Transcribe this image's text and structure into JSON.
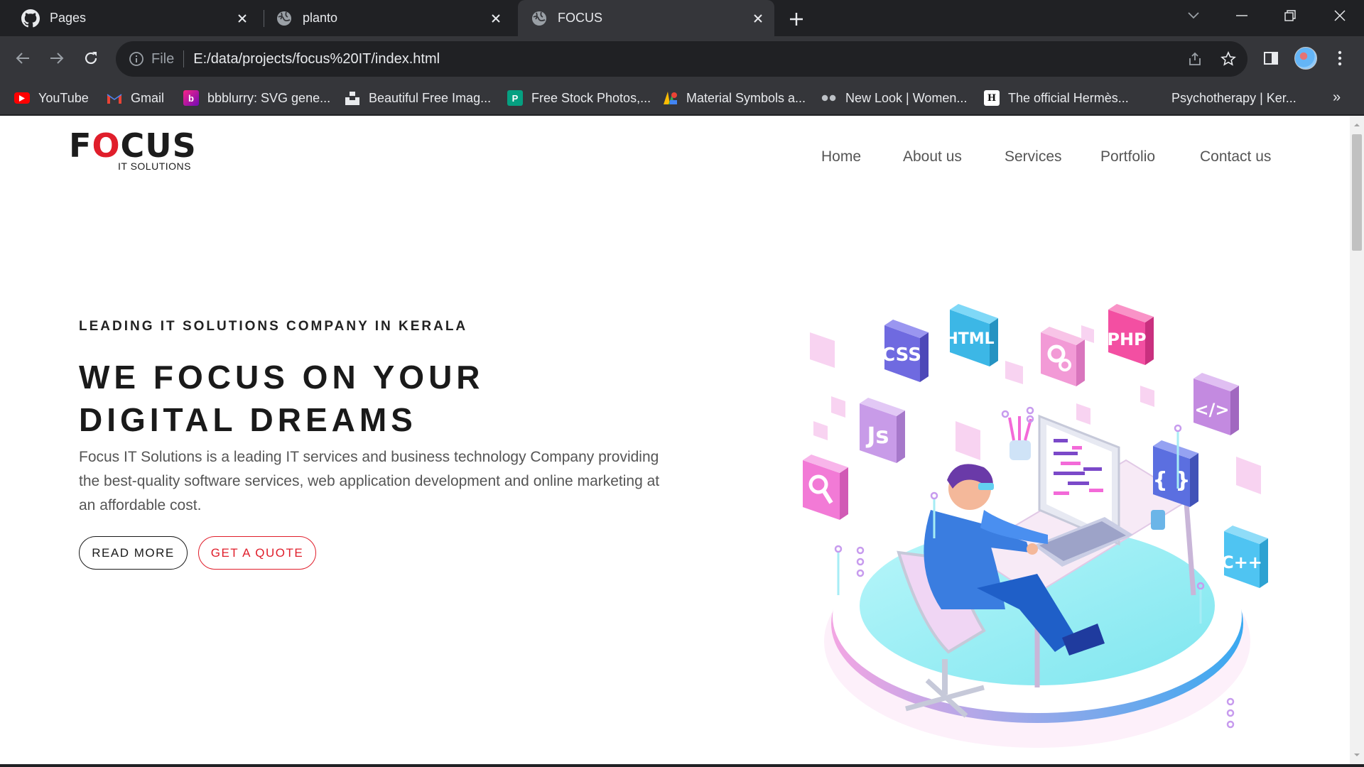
{
  "browser": {
    "tabs": [
      {
        "title": "Pages",
        "icon": "github-icon",
        "active": false
      },
      {
        "title": "planto",
        "icon": "globe-icon",
        "active": false
      },
      {
        "title": "FOCUS",
        "icon": "globe-icon",
        "active": true
      }
    ],
    "omnibox": {
      "scheme": "File",
      "url": "E:/data/projects/focus%20IT/index.html"
    },
    "bookmarks": [
      {
        "label": "YouTube",
        "icon": "youtube-icon",
        "color": "#ff0000"
      },
      {
        "label": "Gmail",
        "icon": "gmail-icon",
        "color": "#ea4335"
      },
      {
        "label": "bbblurry: SVG gene...",
        "icon": "bbblurry-icon",
        "color": "#7b2ff7"
      },
      {
        "label": "Beautiful Free Imag...",
        "icon": "unsplash-icon",
        "color": "#111111"
      },
      {
        "label": "Free Stock Photos,...",
        "icon": "pexels-icon",
        "color": "#05a081"
      },
      {
        "label": "Material Symbols a...",
        "icon": "google-fonts-icon",
        "color": "#fbbc04"
      },
      {
        "label": "New Look | Women...",
        "icon": "newlook-icon",
        "color": "#9aa0a6"
      },
      {
        "label": "The official Hermès...",
        "icon": "hermes-icon",
        "color": "#ffffff"
      },
      {
        "label": "Psychotherapy | Ker...",
        "icon": "blank-icon",
        "color": "#35363a"
      }
    ],
    "more_bookmarks": "»"
  },
  "site": {
    "logo": {
      "word_pre": "F",
      "word_o": "O",
      "word_post": "CUS",
      "sub": "IT SOLUTIONS",
      "accent": "#e01e2b"
    },
    "nav": [
      "Home",
      "About us",
      "Services",
      "Portfolio",
      "Contact us"
    ],
    "hero": {
      "eyebrow": "LEADING IT SOLUTIONS COMPANY IN KERALA",
      "headline_line1": "WE FOCUS ON YOUR",
      "headline_line2": "DIGITAL DREAMS",
      "intro": "Focus IT Solutions is a leading IT services and business technology Company providing the best-quality software services, web application development and online marketing at an affordable cost.",
      "read_more": "READ MORE",
      "get_quote": "GET A QUOTE"
    },
    "illustration_badges": [
      "CSS",
      "HTML",
      "PHP",
      "Js",
      "</>",
      "{ }",
      "C++"
    ]
  }
}
